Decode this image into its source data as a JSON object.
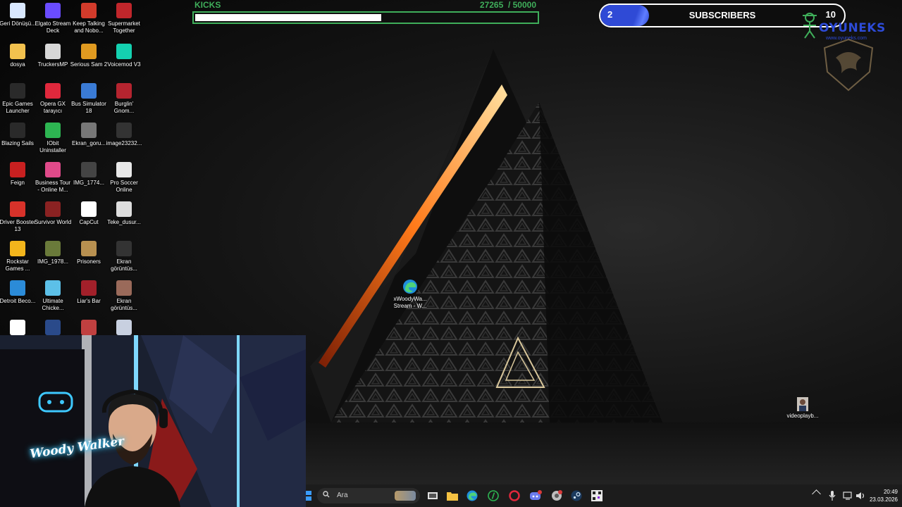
{
  "desktop_icons": [
    {
      "label": "Geri Dönüşü...",
      "icon": "recycle-bin-icon",
      "color": "#d9e8ff"
    },
    {
      "label": "Elgato Stream Deck",
      "icon": "grid-icon",
      "color": "#6a4cff"
    },
    {
      "label": "Keep Talking and Nobo...",
      "icon": "bomb-icon",
      "color": "#d23b2b"
    },
    {
      "label": "Supermarket Together",
      "icon": "store-icon",
      "color": "#c0262b"
    },
    {
      "label": "dosya",
      "icon": "folder-icon",
      "color": "#f2c14e"
    },
    {
      "label": "TruckersMP",
      "icon": "truck-icon",
      "color": "#d8d8d8"
    },
    {
      "label": "Serious Sam 2",
      "icon": "bomb-icon",
      "color": "#e09a20"
    },
    {
      "label": "Voicemod V3",
      "icon": "voice-icon",
      "color": "#14d1b0"
    },
    {
      "label": "Epic Games Launcher",
      "icon": "epic-icon",
      "color": "#2a2a2a"
    },
    {
      "label": "Opera GX tarayıcı",
      "icon": "opera-icon",
      "color": "#e0283c"
    },
    {
      "label": "Bus Simulator 18",
      "icon": "bus-icon",
      "color": "#3a7bd5"
    },
    {
      "label": "Burglin' Gnom...",
      "icon": "gnome-icon",
      "color": "#b5242f"
    },
    {
      "label": "Blazing Sails",
      "icon": "epic-icon",
      "color": "#2a2a2a"
    },
    {
      "label": "IObit Uninstaller",
      "icon": "uninstall-icon",
      "color": "#2db552"
    },
    {
      "label": "Ekran_goru...",
      "icon": "image-icon",
      "color": "#777777"
    },
    {
      "label": "image23232...",
      "icon": "image-icon",
      "color": "#333333"
    },
    {
      "label": "Feign",
      "icon": "feign-icon",
      "color": "#c82020"
    },
    {
      "label": "Business Tour - Online M...",
      "icon": "dice-icon",
      "color": "#e04a8a"
    },
    {
      "label": "IMG_1774...",
      "icon": "image-icon",
      "color": "#444444"
    },
    {
      "label": "Pro Soccer Online",
      "icon": "soccer-icon",
      "color": "#e8e8e8"
    },
    {
      "label": "Driver Booster 13",
      "icon": "booster-icon",
      "color": "#d8322a"
    },
    {
      "label": "Survivor World",
      "icon": "game-icon",
      "color": "#8a2222"
    },
    {
      "label": "CapCut",
      "icon": "capcut-icon",
      "color": "#ffffff"
    },
    {
      "label": "Teke_dusur...",
      "icon": "file-icon",
      "color": "#dddddd"
    },
    {
      "label": "Rockstar Games ...",
      "icon": "rockstar-icon",
      "color": "#f2b51c"
    },
    {
      "label": "IMG_1978...",
      "icon": "image-icon",
      "color": "#6a7a3a"
    },
    {
      "label": "Prisoners",
      "icon": "game-icon",
      "color": "#b89050"
    },
    {
      "label": "Ekran görüntüs...",
      "icon": "image-icon",
      "color": "#333333"
    },
    {
      "label": "Detroit Beco...",
      "icon": "detroit-icon",
      "color": "#2b8bd8"
    },
    {
      "label": "Ultimate Chicke...",
      "icon": "game-icon",
      "color": "#5cc0e8"
    },
    {
      "label": "Liar's Bar",
      "icon": "game-icon",
      "color": "#a2202a"
    },
    {
      "label": "Ekran görüntüs...",
      "icon": "image-icon",
      "color": "#9a6a5a"
    },
    {
      "label": "",
      "icon": "photoshop-icon",
      "color": "#ffffff"
    },
    {
      "label": "",
      "icon": "image-icon",
      "color": "#2a4a8a"
    },
    {
      "label": "",
      "icon": "game-icon",
      "color": "#c04040"
    },
    {
      "label": "",
      "icon": "image-icon",
      "color": "#c8d0e0"
    }
  ],
  "kicks": {
    "title": "KICKS",
    "current": "27265",
    "goal": "/ 50000",
    "progress": 0.5453,
    "color": "#3fae5a"
  },
  "subscribers": {
    "current": "2",
    "label": "SUBSCRIBERS",
    "goal": "10",
    "progress": 0.2,
    "color": "#2f4ad6"
  },
  "brand": {
    "name": "OYUNEKS",
    "url": "www.oyuneks.com"
  },
  "center_icon": {
    "label": "xWoodyWa... Stream - W...",
    "icon": "edge-icon"
  },
  "right_icon": {
    "label": "videoplayb...",
    "icon": "video-icon"
  },
  "webcam": {
    "sign_text": "Woody Walker"
  },
  "taskbar": {
    "search_placeholder": "Ara",
    "apps": [
      "task-view-icon",
      "file-explorer-icon",
      "edge-icon",
      "uninstall-icon",
      "opera-icon",
      "discord-icon",
      "chrome-icon",
      "steam-icon",
      "qr-app-icon"
    ],
    "time": "20:49",
    "date": "23.03.2026"
  }
}
